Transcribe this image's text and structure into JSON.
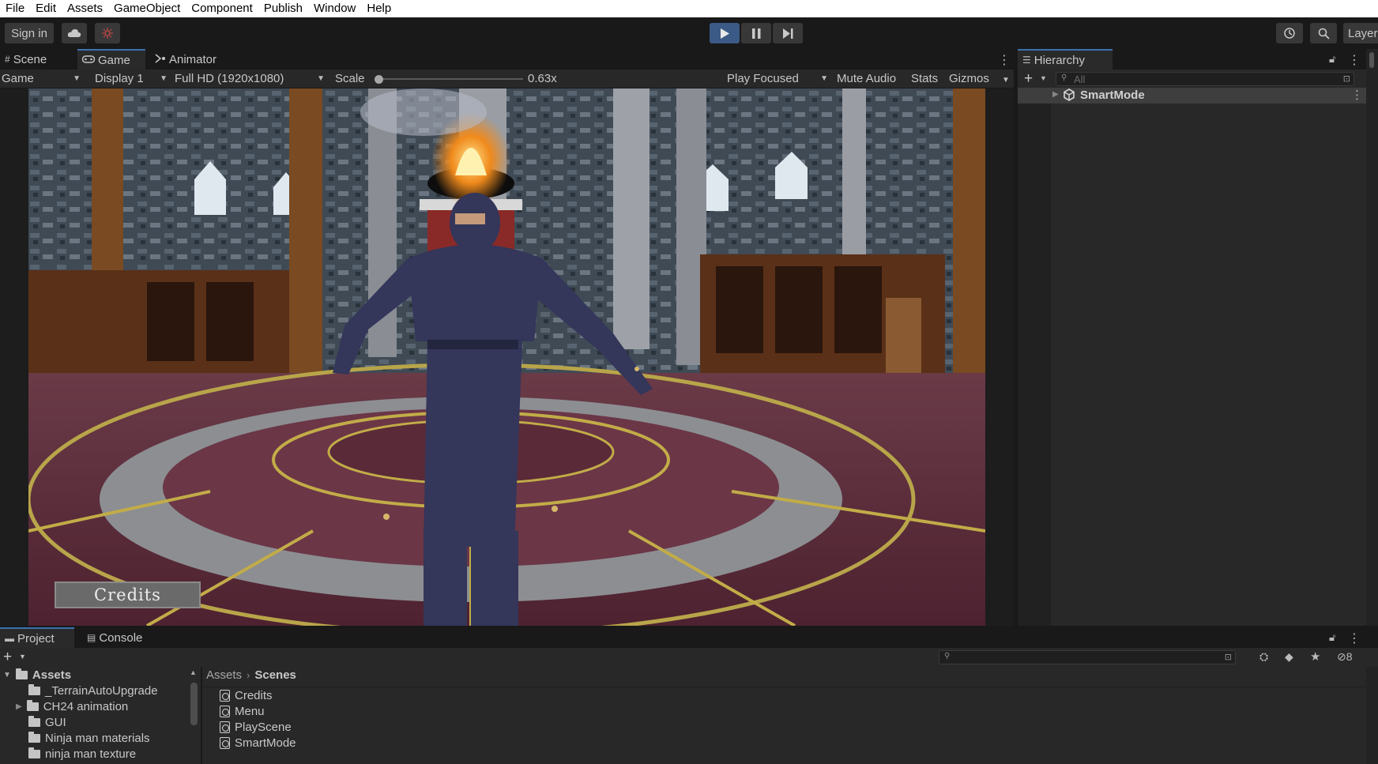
{
  "menu": [
    "File",
    "Edit",
    "Assets",
    "GameObject",
    "Component",
    "Publish",
    "Window",
    "Help"
  ],
  "toolbar": {
    "sign_in": "Sign in",
    "layers": "Layers"
  },
  "view_tabs": [
    {
      "label": "Scene",
      "icon": "grid-icon",
      "active": false
    },
    {
      "label": "Game",
      "icon": "gamepad-icon",
      "active": true
    },
    {
      "label": "Animator",
      "icon": "animator-icon",
      "active": false
    }
  ],
  "game_toolbar": {
    "view_mode": "Game",
    "display": "Display 1",
    "resolution": "Full HD (1920x1080)",
    "scale_label": "Scale",
    "scale_value": "0.63x",
    "play_focus": "Play Focused",
    "mute": "Mute Audio",
    "stats": "Stats",
    "gizmos": "Gizmos"
  },
  "game_view": {
    "credits_button": "Credits",
    "scene_description_icon": "ninja-character-scene"
  },
  "hierarchy": {
    "tab": "Hierarchy",
    "search_placeholder": "All",
    "root_item": "SmartMode"
  },
  "bottom_tabs": [
    {
      "label": "Project",
      "icon": "folder-icon",
      "active": true
    },
    {
      "label": "Console",
      "icon": "console-icon",
      "active": false
    }
  ],
  "project": {
    "hidden_count": "8",
    "tree_root": "Assets",
    "tree": [
      "_TerrainAutoUpgrade",
      "CH24 animation",
      "GUI",
      "Ninja man materials",
      "ninja man texture"
    ],
    "breadcrumb": [
      "Assets",
      "Scenes"
    ],
    "files": [
      "Credits",
      "Menu",
      "PlayScene",
      "SmartMode"
    ]
  },
  "colors": {
    "accent": "#3a72b0",
    "play_active": "#3b5a86",
    "panel_bg": "#282828",
    "window_bg": "#191919"
  }
}
